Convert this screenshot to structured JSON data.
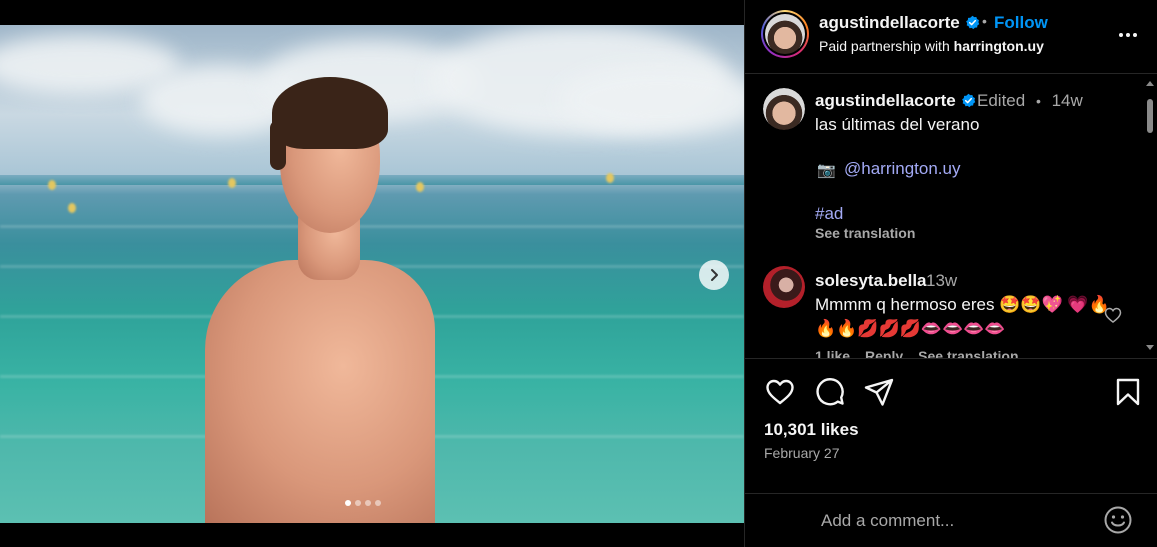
{
  "post": {
    "author": "agustindellacorte",
    "follow_label": "Follow",
    "separator": "•",
    "partnership_prefix": "Paid partnership with",
    "partner": "harrington.uy",
    "more_icon": "more-horizontal-icon"
  },
  "caption": {
    "author": "agustindellacorte",
    "edited": "Edited",
    "separator": "•",
    "age": "14w",
    "text": "las últimas del verano",
    "camera_emoji": "📷",
    "mention": "@harrington.uy",
    "hashtag": "#ad",
    "see_translation": "See translation"
  },
  "comments": [
    {
      "author": "solesyta.bella",
      "age": "13w",
      "text": "Mmmm q hermoso eres 🤩🤩💖 💗🔥🔥🔥💋💋💋👄👄👄👄",
      "likes": "1 like",
      "reply": "Reply",
      "see_translation": "See translation"
    }
  ],
  "stats": {
    "likes": "10,301 likes",
    "date": "February 27"
  },
  "composer": {
    "placeholder": "Add a comment..."
  },
  "carousel": {
    "total": 4,
    "active_index": 0
  },
  "colors": {
    "link_blue": "#0095f6",
    "mention": "#a3aaf5",
    "verified": "#0095f6",
    "muted": "#a8a8a8"
  }
}
